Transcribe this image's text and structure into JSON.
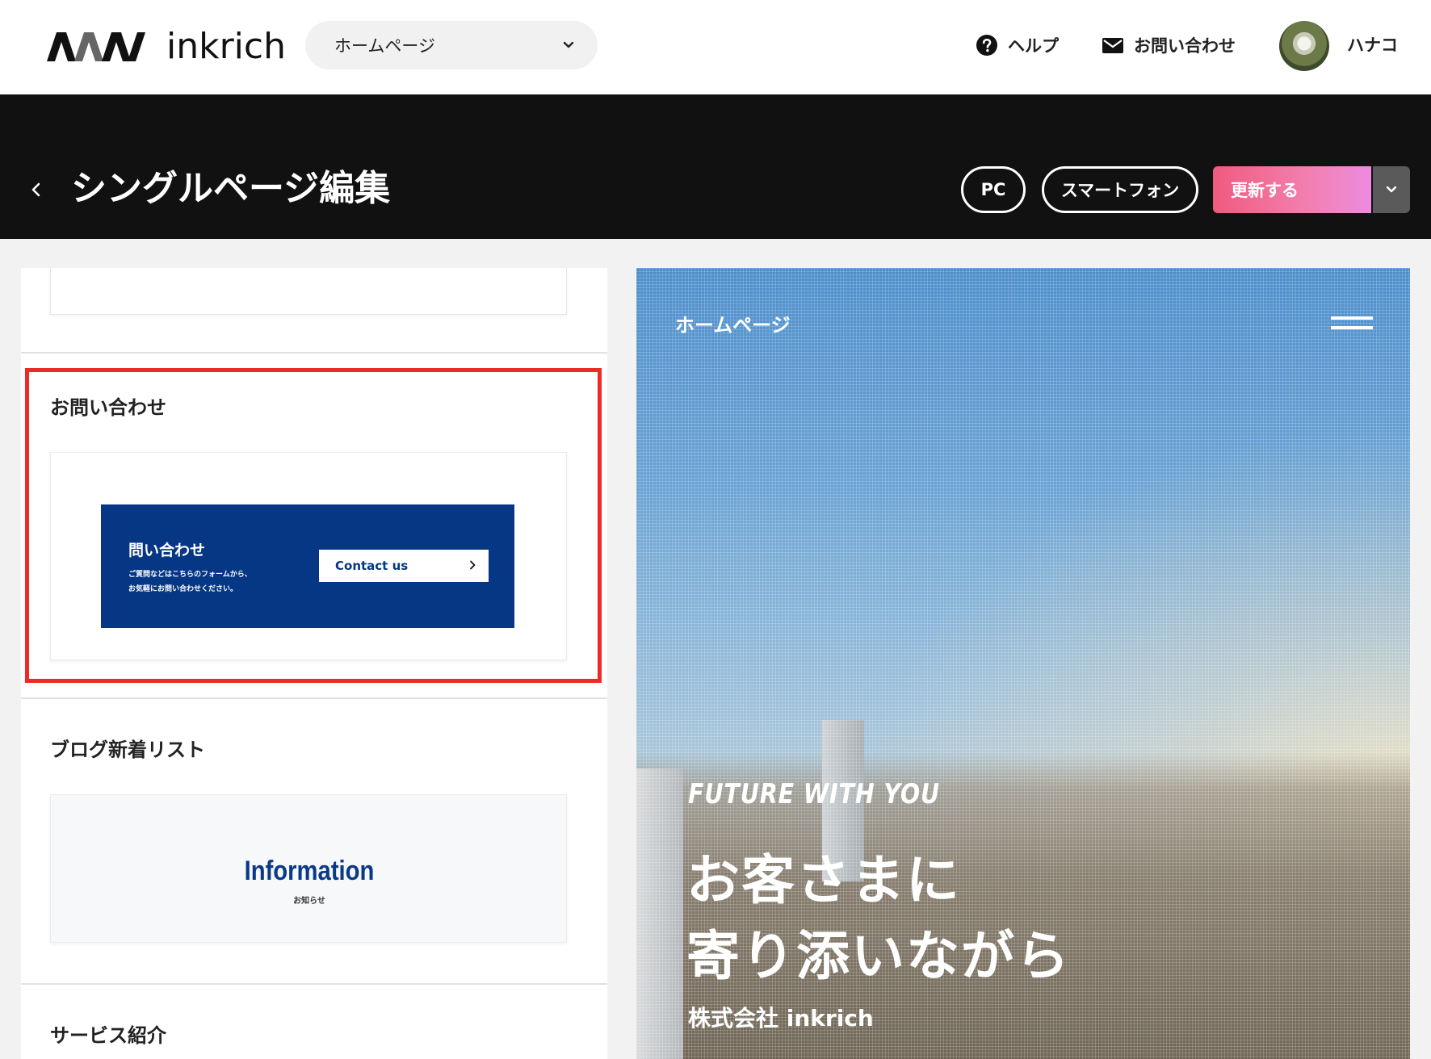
{
  "header": {
    "logo_text": "inkrich",
    "page_selector": {
      "value": "ホームページ"
    },
    "help_label": "ヘルプ",
    "contact_label": "お問い合わせ",
    "user_name": "ハナコ"
  },
  "titlebar": {
    "title": "シングルページ編集",
    "pc_label": "PC",
    "smartphone_label": "スマートフォン",
    "update_label": "更新する",
    "update_color_start": "#f15a7e",
    "update_color_end": "#ee8be0"
  },
  "sections": {
    "contact": {
      "label": "お問い合わせ",
      "banner_title": "問い合わせ",
      "banner_desc_line1": "ご質問などはこちらのフォームから、",
      "banner_desc_line2": "お気軽にお問い合わせください。",
      "banner_button": "Contact us",
      "banner_color": "#053784",
      "highlight_color": "#ee2a24"
    },
    "blog": {
      "label": "ブログ新着リスト",
      "heading": "Information",
      "subheading": "お知らせ"
    },
    "service": {
      "label": "サービス紹介"
    }
  },
  "preview": {
    "site_title": "ホームページ",
    "tagline": "FUTURE WITH YOU",
    "headline_line1": "お客さまに",
    "headline_line2": "寄り添いながら",
    "company": "株式会社 inkrich"
  },
  "icons": {
    "help": "question-circle-icon",
    "mail": "envelope-icon",
    "back": "chevron-left-icon",
    "select": "chevron-down-icon",
    "menu": "hamburger-icon"
  }
}
